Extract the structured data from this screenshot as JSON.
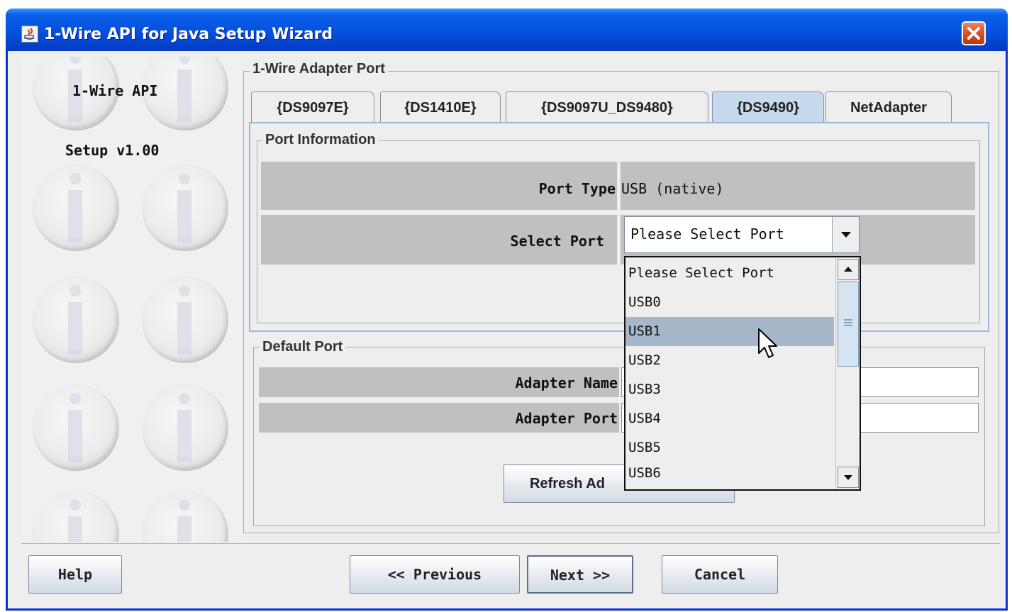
{
  "window": {
    "title": "1-Wire API for Java Setup Wizard"
  },
  "sidebar": {
    "line1": "1-Wire API",
    "line2": "Setup v1.00"
  },
  "adapter_group": {
    "title": "1-Wire Adapter Port",
    "tabs": [
      {
        "label": "{DS9097E}",
        "selected": false
      },
      {
        "label": "{DS1410E}",
        "selected": false
      },
      {
        "label": "{DS9097U_DS9480}",
        "selected": false
      },
      {
        "label": "{DS9490}",
        "selected": true
      },
      {
        "label": "NetAdapter",
        "selected": false
      }
    ]
  },
  "port_info": {
    "title": "Port Information",
    "port_type_label": "Port Type",
    "port_type_value": "USB (native)",
    "select_port_label": "Select Port",
    "select_port_value": "Please Select Port"
  },
  "dropdown": {
    "items": [
      "Please Select Port",
      "USB0",
      "USB1",
      "USB2",
      "USB3",
      "USB4",
      "USB5",
      "USB6"
    ],
    "hover_index": 2
  },
  "default_port": {
    "title": "Default Port",
    "adapter_name_label": "Adapter Name",
    "adapter_name_value": "",
    "adapter_port_label": "Adapter Port",
    "adapter_port_value": "",
    "refresh_label_visible": "Refresh Ad"
  },
  "footer": {
    "help": "Help",
    "previous": "<< Previous",
    "next": "Next >>",
    "cancel": "Cancel"
  },
  "colors": {
    "titlebar": "#0453df",
    "selected_tab": "#c7d9ec",
    "hover_item": "#a5b7c9",
    "label_cell": "#c0c0c0"
  }
}
